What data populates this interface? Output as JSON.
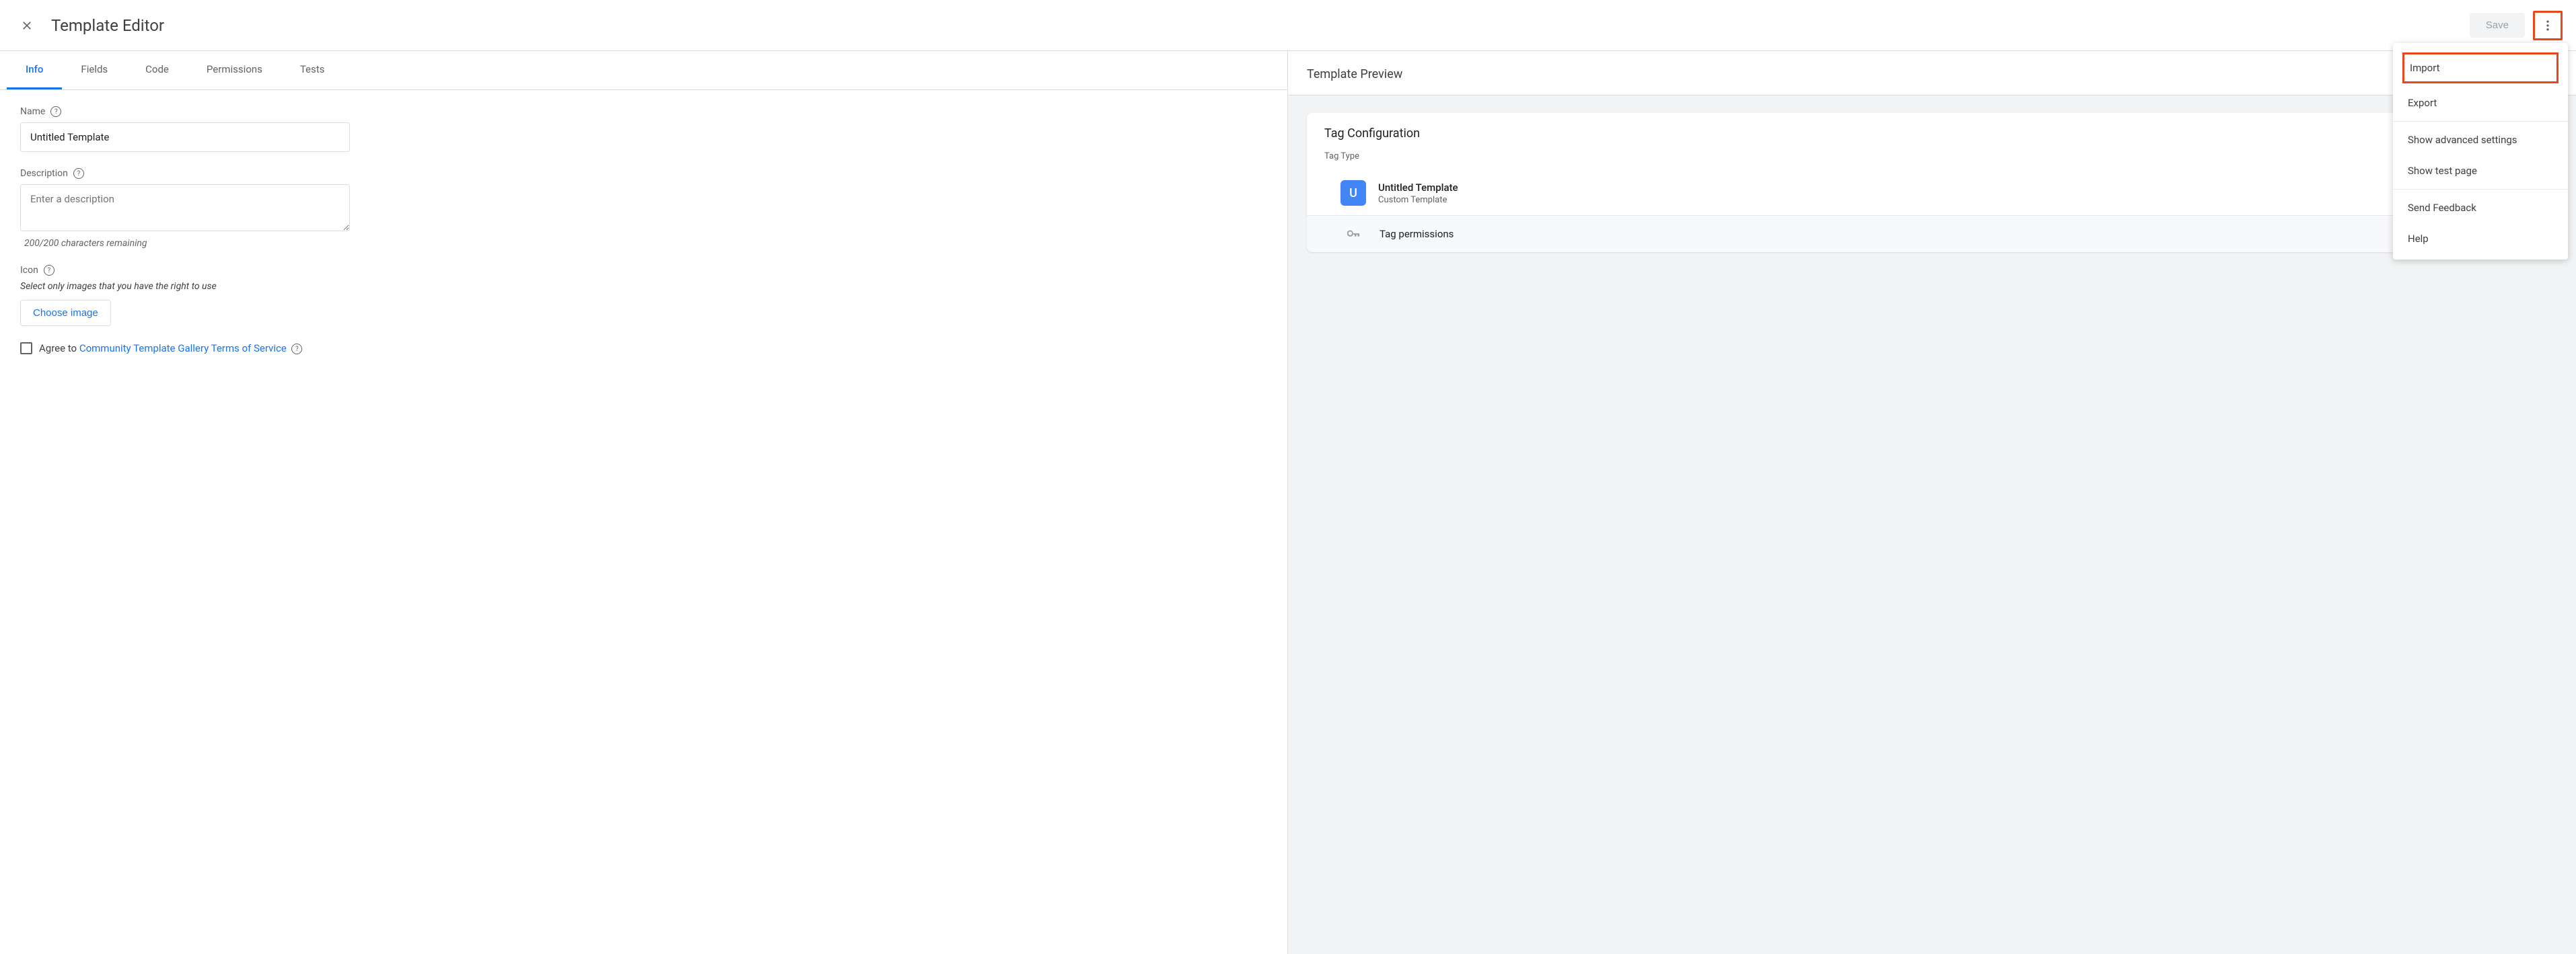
{
  "header": {
    "title": "Template Editor",
    "save_label": "Save"
  },
  "tabs": {
    "info": "Info",
    "fields": "Fields",
    "code": "Code",
    "permissions": "Permissions",
    "tests": "Tests"
  },
  "form": {
    "name_label": "Name",
    "name_value": "Untitled Template",
    "description_label": "Description",
    "description_placeholder": "Enter a description",
    "char_remaining": "200/200 characters remaining",
    "icon_label": "Icon",
    "icon_note": "Select only images that you have the right to use",
    "choose_image_label": "Choose image",
    "agree_prefix": "Agree to ",
    "agree_link": "Community Template Gallery Terms of Service"
  },
  "preview": {
    "title": "Template Preview",
    "card_title": "Tag Configuration",
    "tag_type_label": "Tag Type",
    "tag_name": "Untitled Template",
    "tag_sub": "Custom Template",
    "tag_badge_letter": "U",
    "permissions_label": "Tag permissions"
  },
  "menu": {
    "import": "Import",
    "export": "Export",
    "advanced": "Show advanced settings",
    "test_page": "Show test page",
    "feedback": "Send Feedback",
    "help": "Help"
  }
}
